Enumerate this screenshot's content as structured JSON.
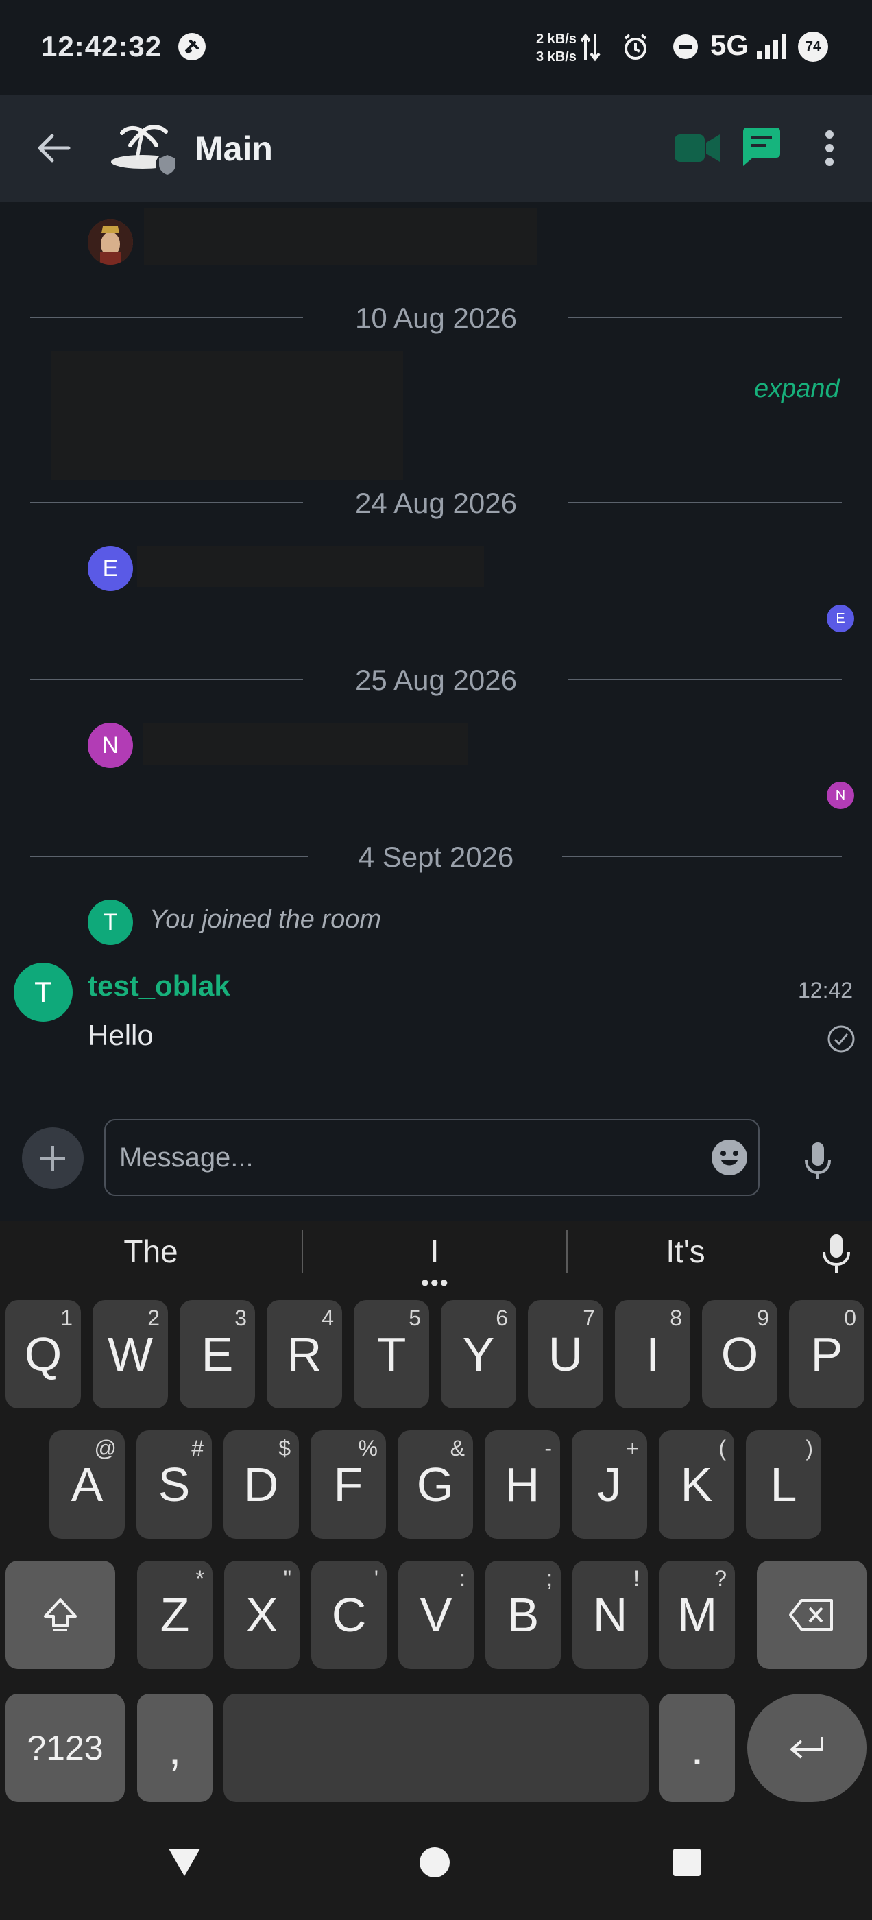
{
  "status_bar": {
    "time": "12:42:32",
    "net_up": "2 kB/s",
    "net_down": "3 kB/s",
    "network": "5G",
    "battery": "74"
  },
  "header": {
    "title": "Main"
  },
  "timeline": {
    "dates": [
      "10 Aug 2026",
      "24 Aug 2026",
      "25 Aug 2026",
      "4 Sept 2026"
    ],
    "expand_label": "expand",
    "avatar_e": "E",
    "avatar_n": "N",
    "avatar_t": "T",
    "joined_text": "You joined the room",
    "message": {
      "sender": "test_oblak",
      "time": "12:42",
      "body": "Hello"
    }
  },
  "composer": {
    "placeholder": "Message..."
  },
  "keyboard": {
    "suggestions": [
      "The",
      "I",
      "It's"
    ],
    "row1": [
      {
        "k": "Q",
        "h": "1"
      },
      {
        "k": "W",
        "h": "2"
      },
      {
        "k": "E",
        "h": "3"
      },
      {
        "k": "R",
        "h": "4"
      },
      {
        "k": "T",
        "h": "5"
      },
      {
        "k": "Y",
        "h": "6"
      },
      {
        "k": "U",
        "h": "7"
      },
      {
        "k": "I",
        "h": "8"
      },
      {
        "k": "O",
        "h": "9"
      },
      {
        "k": "P",
        "h": "0"
      }
    ],
    "row2": [
      {
        "k": "A",
        "h": "@"
      },
      {
        "k": "S",
        "h": "#"
      },
      {
        "k": "D",
        "h": "$"
      },
      {
        "k": "F",
        "h": "%"
      },
      {
        "k": "G",
        "h": "&"
      },
      {
        "k": "H",
        "h": "-"
      },
      {
        "k": "J",
        "h": "+"
      },
      {
        "k": "K",
        "h": "("
      },
      {
        "k": "L",
        "h": ")"
      }
    ],
    "row3": [
      {
        "k": "Z",
        "h": "*"
      },
      {
        "k": "X",
        "h": "\""
      },
      {
        "k": "C",
        "h": "'"
      },
      {
        "k": "V",
        "h": ":"
      },
      {
        "k": "B",
        "h": ";"
      },
      {
        "k": "N",
        "h": "!"
      },
      {
        "k": "M",
        "h": "?"
      }
    ],
    "symbols_label": "?123",
    "comma": ",",
    "period": "."
  },
  "colors": {
    "accent": "#17b07b",
    "avatar_e": "#5a5ae6",
    "avatar_n": "#b23cb5",
    "avatar_t": "#0fa97a"
  }
}
